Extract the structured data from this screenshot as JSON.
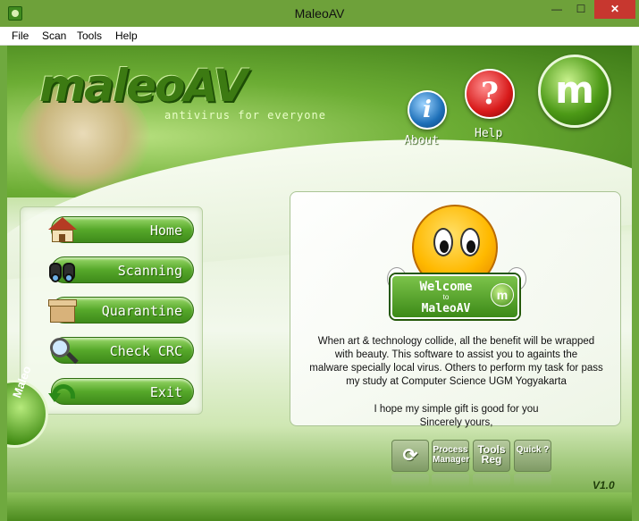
{
  "window": {
    "title": "MaleoAV",
    "minimize_glyph": "—",
    "maximize_glyph": "☐",
    "close_glyph": "✕"
  },
  "menu": [
    "File",
    "Scan",
    "Tools",
    "Help"
  ],
  "header": {
    "logo_text": "maleoAV",
    "tagline": "antivirus for everyone",
    "about_label": "About",
    "help_label": "Help",
    "about_glyph": "i",
    "help_glyph": "?",
    "m_glyph": "m"
  },
  "nav": [
    {
      "label": "Home",
      "icon": "home-icon"
    },
    {
      "label": "Scanning",
      "icon": "binoculars-icon"
    },
    {
      "label": "Quarantine",
      "icon": "box-icon"
    },
    {
      "label": "Check CRC",
      "icon": "magnifier-icon"
    },
    {
      "label": "Exit",
      "icon": "exit-arrow-icon"
    }
  ],
  "welcome": {
    "line1": "Welcome",
    "line2": "to",
    "line3": "MaleoAV",
    "badge_glyph": "m"
  },
  "content": {
    "paragraph1_lines": [
      "When art & technology collide, all the benefit will be wrapped",
      "with beauty. This software to assist you to againts the",
      "malware specially local virus. Others to perform my task for pass",
      "my study at Computer Science UGM Yogyakarta"
    ],
    "paragraph2_lines": [
      "I hope my simple gift is good for you",
      "Sincerely yours,"
    ]
  },
  "side_disc_text": "Maleo",
  "tools": {
    "refresh_glyph": "⟳",
    "process_manager": "Process Manager",
    "tools_reg": "Tools Reg",
    "quick": "Quick ?"
  },
  "version": "V1.0",
  "colors": {
    "titlebar": "#6ea13a",
    "accent_green": "#3e8a1a",
    "close_red": "#c7372f"
  }
}
